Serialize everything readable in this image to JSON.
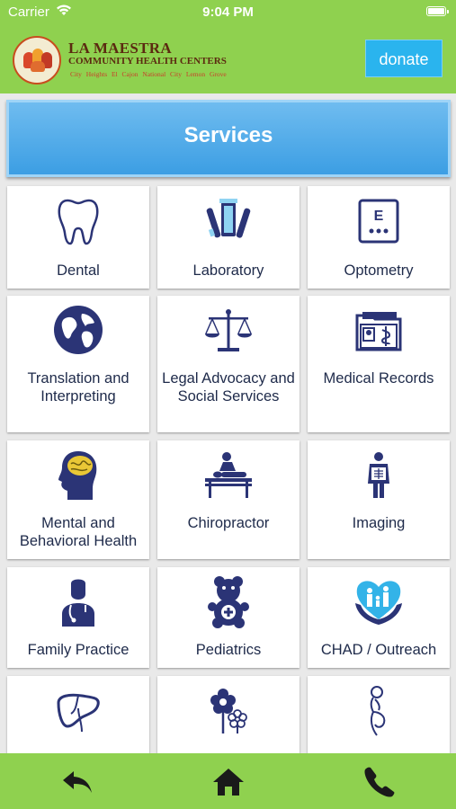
{
  "status_bar": {
    "carrier": "Carrier",
    "time": "9:04 PM"
  },
  "header": {
    "logo": {
      "name": "LA MAESTRA",
      "subtitle": "COMMUNITY HEALTH CENTERS",
      "cities": "City Heights   El Cajon   National City   Lemon Grove"
    },
    "donate_label": "donate"
  },
  "banner": {
    "title": "Services"
  },
  "services": [
    {
      "label": "Dental",
      "icon": "tooth-icon"
    },
    {
      "label": "Laboratory",
      "icon": "lab-tubes-icon"
    },
    {
      "label": "Optometry",
      "icon": "eye-chart-icon"
    },
    {
      "label": "Translation and Interpreting",
      "icon": "globe-icon"
    },
    {
      "label": "Legal Advocacy and Social Services",
      "icon": "scales-icon"
    },
    {
      "label": "Medical Records",
      "icon": "records-folder-icon"
    },
    {
      "label": "Mental and Behavioral Health",
      "icon": "brain-head-icon"
    },
    {
      "label": "Chiropractor",
      "icon": "massage-table-icon"
    },
    {
      "label": "Imaging",
      "icon": "xray-icon"
    },
    {
      "label": "Family Practice",
      "icon": "doctor-icon"
    },
    {
      "label": "Pediatrics",
      "icon": "teddy-bear-icon"
    },
    {
      "label": "CHAD / Outreach",
      "icon": "family-heart-icon"
    },
    {
      "label": "",
      "icon": "liver-icon"
    },
    {
      "label": "",
      "icon": "flower-icon"
    },
    {
      "label": "",
      "icon": "pregnant-woman-icon"
    }
  ],
  "tab_bar": {
    "items": [
      {
        "name": "back",
        "icon": "back-arrow-icon"
      },
      {
        "name": "home",
        "icon": "home-icon"
      },
      {
        "name": "call",
        "icon": "phone-icon"
      }
    ]
  },
  "colors": {
    "brand_green": "#8fd14f",
    "donate_blue": "#2ab4ee",
    "banner_blue": "#4aa8e8",
    "icon_navy": "#2b3476"
  }
}
